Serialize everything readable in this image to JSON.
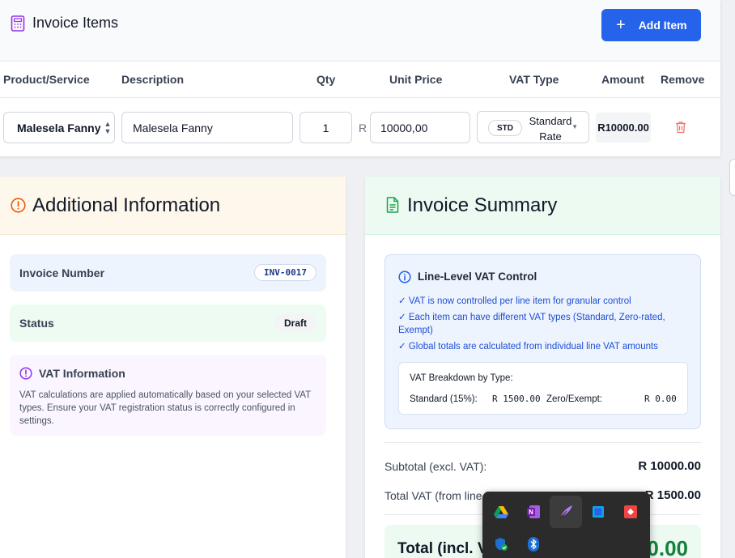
{
  "items": {
    "title": "Invoice Items",
    "add_button": "Add Item",
    "columns": {
      "product": "Product/Service",
      "description": "Description",
      "qty": "Qty",
      "unit_price": "Unit Price",
      "vat_type": "VAT Type",
      "amount": "Amount",
      "remove": "Remove"
    },
    "rows": [
      {
        "product": "Malesela Fanny",
        "description": "Malesela Fanny",
        "qty": "1",
        "currency": "R",
        "unit_price": "10000,00",
        "vat_badge": "STD",
        "vat_label_line1": "Standard",
        "vat_label_line2": "Rate",
        "amount": "R10000.00"
      }
    ]
  },
  "additional": {
    "title": "Additional Information",
    "invoice_number_label": "Invoice Number",
    "invoice_number": "INV-0017",
    "status_label": "Status",
    "status": "Draft",
    "vat_info_title": "VAT Information",
    "vat_info_text": "VAT calculations are applied automatically based on your selected VAT types. Ensure your VAT registration status is correctly configured in settings."
  },
  "summary": {
    "title": "Invoice Summary",
    "vat_control_title": "Line-Level VAT Control",
    "vat_control_points": [
      "✓ VAT is now controlled per line item for granular control",
      "✓ Each item can have different VAT types (Standard, Zero-rated, Exempt)",
      "✓ Global totals are calculated from individual line VAT amounts"
    ],
    "breakdown_title": "VAT Breakdown by Type:",
    "standard_label": "Standard (15%):",
    "standard_value": "R 1500.00",
    "zero_label": "Zero/Exempt:",
    "zero_value": "R 0.00",
    "subtotal_label": "Subtotal (excl. VAT):",
    "subtotal_value": "R 10000.00",
    "total_vat_label": "Total VAT (from line items):",
    "total_vat_value": "R 1500.00",
    "total_label": "Total (incl. VAT):",
    "total_value": "R 11500.00"
  },
  "tray": {
    "icons": [
      "google-drive-icon",
      "onenote-icon",
      "quill-icon",
      "store-icon",
      "anydesk-icon",
      "windows-security-icon",
      "bluetooth-icon"
    ]
  },
  "colors": {
    "accent": "#2563eb",
    "success": "#15803d",
    "danger": "#ef4444",
    "info_blue": "#1d4ed8",
    "warning_orange": "#ea580c",
    "purple": "#9333ea"
  }
}
